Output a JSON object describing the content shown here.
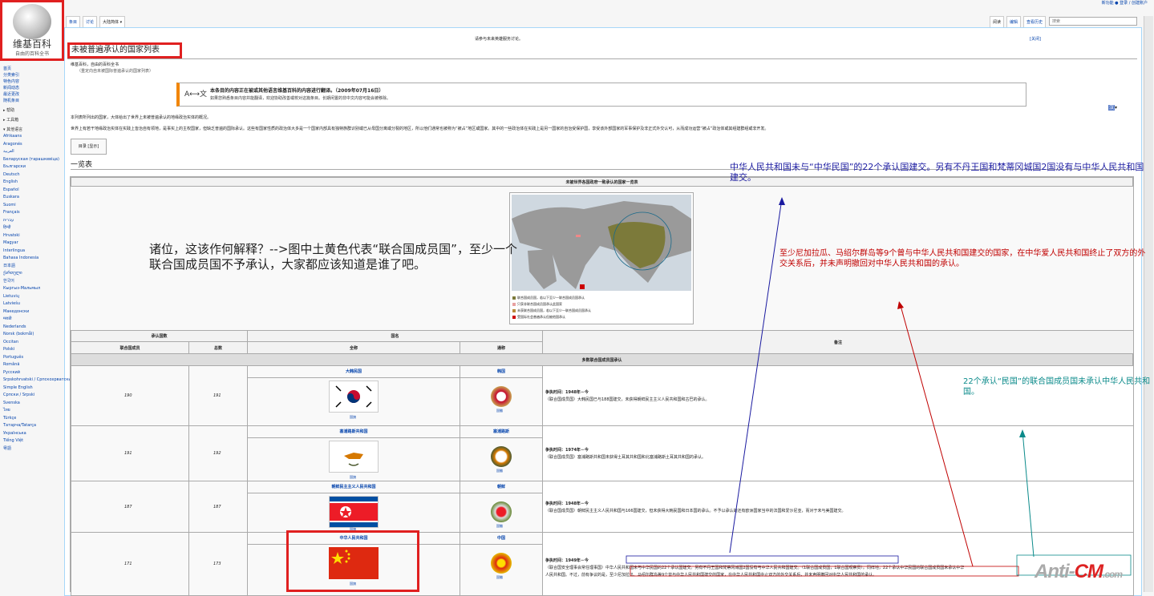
{
  "logo": {
    "title": "维基百科",
    "subtitle": "自由的百科全书"
  },
  "personal": "新功能 ● 登录 / 创建账户",
  "tabs_left": [
    "条目",
    "讨论",
    "大陆简体 ▾"
  ],
  "tabs_right": [
    "阅读",
    "编辑",
    "查看历史"
  ],
  "search": {
    "placeholder": "搜索"
  },
  "sitenotice": "请参与未来英雄服务讨论。",
  "hide_link": "[关闭]",
  "page_title": "未被普遍承认的国家列表",
  "from_line": "维基百科，自由的百科全书",
  "redirect_line": "（重定向自未被国际普遍承认的国家列表）",
  "sidebar": {
    "nav": [
      "首页",
      "分类索引",
      "特色内容",
      "新闻动态",
      "最近更改",
      "随机条目"
    ],
    "sections": [
      "▸ 帮助",
      "▸ 工具箱",
      "▾ 其他语言"
    ],
    "languages": [
      "Afrikaans",
      "Aragonés",
      "العربية",
      "Беларуская (тарашкевіца)",
      "Български",
      "Deutsch",
      "English",
      "Español",
      "Euskara",
      "Suomi",
      "Français",
      "עברית",
      "हिन्दी",
      "Hrvatski",
      "Magyar",
      "Interlingua",
      "Bahasa Indonesia",
      "日本語",
      "ქართული",
      "한국어",
      "Кыргыз-Мальмыл",
      "Lietuvių",
      "Latviešu",
      "Македонски",
      "मराठी",
      "Nederlands",
      "Norsk (bokmål)",
      "Occitan",
      "Polski",
      "Português",
      "Română",
      "Русский",
      "Srpskohrvatski / Српскохрватски",
      "Simple English",
      "Српски / Srpski",
      "Svenska",
      "ไทย",
      "Türkçe",
      "Татарча/Tatarça",
      "Українська",
      "Tiếng Việt",
      "粵語"
    ]
  },
  "notice": {
    "line1": "本条目的内容正在被或其他语言维基百科的内容进行翻译。（2009年07月16日）",
    "line2": "如果您熟悉条目内容并能翻译，欢迎协助改善或校对这篇条目。长期闲置的非中文内容可能会被移除。",
    "icon": "A⟷文"
  },
  "lang_toggle": "汉",
  "paragraphs": [
    "本列表所列出的国家，大体给出了世界上未被普遍承认的地缘政治实体的概况。",
    "世界上有若干地缘政治实体在实践上皆治自有领地，是事实上的主权国家，但缺乏普遍的国际承认。这些有国家性质的政治体大多是一个国家内部具有独特族群识别或已从母国分离或分裂的地区，所以他们通常也被称为“被占”地区或国家。其中的一些政治体在实践上是另一国家的自治受保护国，享受该外部国家的军事保护及非正式外交认可，从而成功运营“被占”政治体或其组建群组或非开发。"
  ],
  "toc": "目录 [显示]",
  "section_heading": "一览表",
  "table": {
    "caption": "未被世界各国政府一致承认的国家一览表",
    "header": {
      "recognition": "承认国数",
      "un_members": "联合国成员",
      "total": "总数",
      "name": "国名",
      "full": "全称",
      "short": "通称",
      "remarks": "备注"
    },
    "group": "多数联合国成员国承认",
    "flag_caption": "国旗",
    "emblem_caption": "国徽",
    "legend": [
      "联合国成员国，若以下至少一联合国成员国承认",
      "只获非联合国成员国承认此国家",
      "未获联合国成员国，若以下至少一联合国成员国承认",
      "受国际社会普遍承认但被他国承认"
    ],
    "rows": [
      {
        "un": "190",
        "total": "191",
        "full": "大韩民国",
        "short": "韩国",
        "note1": "争执时间：1948年－今",
        "note2": "（联合国成员国）大韩民国已与188国建交，未获得朝鲜民主主义人民共和国和古巴的承认。"
      },
      {
        "un": "191",
        "total": "192",
        "full": "塞浦路斯共和国",
        "short": "塞浦路斯",
        "note1": "争执时间：1974年－今",
        "note2": "（联合国成员国）塞浦路斯共和国未获得土耳其共和国和北塞浦路斯土耳其共和国的承认。"
      },
      {
        "un": "187",
        "total": "187",
        "full": "朝鲜民主主义人民共和国",
        "short": "朝鲜",
        "note1": "争执时间：1948年－今",
        "note2": "（联合国成员国）朝鲜民主主义人民共和国与166国建交，但未获得大韩民国和日本国的承认。不予以承认的还有欧洲国家当中的法国和爱沙尼亚，而对于未与美国建交。"
      },
      {
        "un": "171",
        "total": "173",
        "full": "中华人民共和国",
        "short": "中国",
        "note1": "争执时间：1949年－今",
        "note2": "（联合国安全理事会常任理事国）中华人民共和国未与中华民国的22个承认国建交。另有不丹王国和梵蒂冈城国2国没有与中华人民共和国建交。（1联合国成员国，1联合国观察员）。同样地，22个承认中华民国的联合国成员国未承认中华",
        "note3": "人民共和国。不过，前有争议的是，至少尼加拉瓜、马绍尔群岛等9个曾与中华人民共和国建交的国家，在中华人民共和国中止双方的外交关系后，并未声明撤回对中华人民共和国的承认。"
      }
    ]
  },
  "annotations": {
    "big": "诸位，这该作何解释？-->图中土黄色代表“联合国成员国”，至少一个联合国成员国不予承认，大家都应该知道是谁了吧。",
    "blue": "中华人民共和国未与“中华民国”的22个承认国建交。另有不丹王国和梵蒂冈城国2国没有与中华人民共和国建交。",
    "red": "至少尼加拉瓜、马绍尔群岛等9个曾与中华人民共和国建交的国家，在中华爱人民共和国终止了双方的外交关系后，并未声明撤回对中华人民共和国的承认。",
    "teal": "22个承认“民国”的联合国成员国未承认中华人民共和国。"
  },
  "watermark": {
    "a": "Anti-",
    "b": "CM",
    "c": ".com"
  },
  "colors": {
    "highlight": "#e02020",
    "link": "#0645ad",
    "blue_ann": "#1a1aa0",
    "red_ann": "#c00000",
    "teal_ann": "#0a8a8a"
  }
}
